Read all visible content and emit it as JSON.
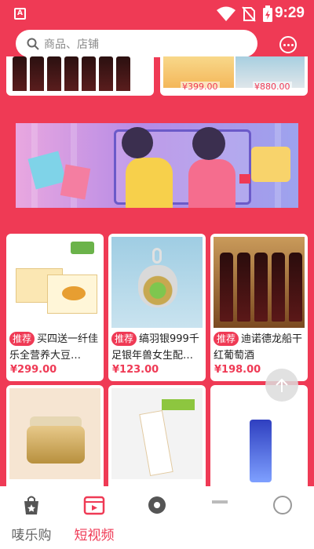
{
  "status_bar": {
    "time": "9:29",
    "app_badge": "A"
  },
  "search": {
    "placeholder": "商品、店铺"
  },
  "top_row_prices": [
    "¥399.00",
    "¥880.00"
  ],
  "products": [
    {
      "tag": "推荐",
      "title": "买四送一纤佳乐全营养大豆…",
      "price": "¥299.00"
    },
    {
      "tag": "推荐",
      "title": "缟羽银999千足银年兽女生配…",
      "price": "¥123.00"
    },
    {
      "tag": "推荐",
      "title": "迪诺德龙船干红葡萄酒",
      "price": "¥198.00"
    }
  ],
  "bottom_nav": {
    "items": [
      {
        "label": "唛乐购",
        "active": false
      },
      {
        "label": "短视频",
        "active": true
      }
    ]
  },
  "colors": {
    "accent": "#ef3a55",
    "nav_inactive": "#666666"
  }
}
